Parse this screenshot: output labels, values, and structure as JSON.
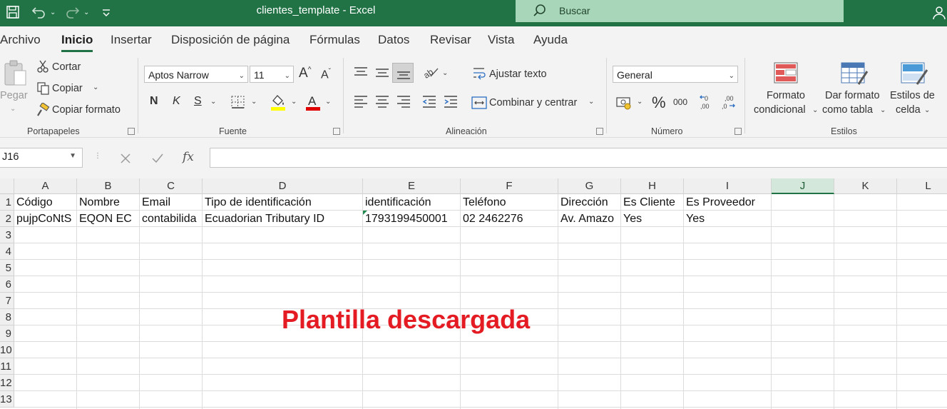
{
  "window": {
    "title": "clientes_template  -  Excel",
    "search_placeholder": "Buscar"
  },
  "menu": {
    "tabs": [
      "Archivo",
      "Inicio",
      "Insertar",
      "Disposición de página",
      "Fórmulas",
      "Datos",
      "Revisar",
      "Vista",
      "Ayuda"
    ],
    "active": "Inicio"
  },
  "ribbon": {
    "clipboard": {
      "label": "Portapapeles",
      "paste": "Pegar",
      "cut": "Cortar",
      "copy": "Copiar",
      "format_painter": "Copiar formato"
    },
    "font": {
      "label": "Fuente",
      "font_name": "Aptos Narrow",
      "font_size": "11",
      "bold": "N",
      "italic": "K",
      "underline": "S"
    },
    "alignment": {
      "label": "Alineación",
      "wrap_text": "Ajustar texto",
      "merge_center": "Combinar y centrar"
    },
    "number": {
      "label": "Número",
      "format": "General",
      "percent": "%",
      "thousands": "000"
    },
    "styles": {
      "label": "Estilos",
      "conditional_line1": "Formato",
      "conditional_line2": "condicional",
      "table_line1": "Dar formato",
      "table_line2": "como tabla",
      "cell_styles_line1": "Estilos de",
      "cell_styles_line2": "celda"
    }
  },
  "formula_bar": {
    "name_box": "J16",
    "fx": "fx",
    "formula": ""
  },
  "sheet": {
    "columns": [
      "A",
      "B",
      "C",
      "D",
      "E",
      "F",
      "G",
      "H",
      "I",
      "J",
      "K",
      "L"
    ],
    "selected_column": "J",
    "rows": [
      "1",
      "2",
      "3",
      "4",
      "5",
      "6",
      "7",
      "8",
      "9",
      "10",
      "11",
      "12",
      "13"
    ],
    "header_row": [
      "Código",
      "Nombre",
      "Email",
      "Tipo de identificación",
      "identificación",
      "Teléfono",
      "Dirección",
      "Es Cliente",
      "Es Proveedor"
    ],
    "data_row": [
      "pujpCoNtS",
      "EQON EC",
      "contabilida",
      "Ecuadorian Tributary ID",
      "1793199450001",
      "02 2462276",
      "Av. Amazo",
      "Yes",
      "Yes"
    ]
  },
  "annotation": {
    "text": "Plantilla descargada",
    "color": "#e41b23"
  },
  "colors": {
    "accent": "#217346",
    "search_bg": "#a8d6b8"
  }
}
